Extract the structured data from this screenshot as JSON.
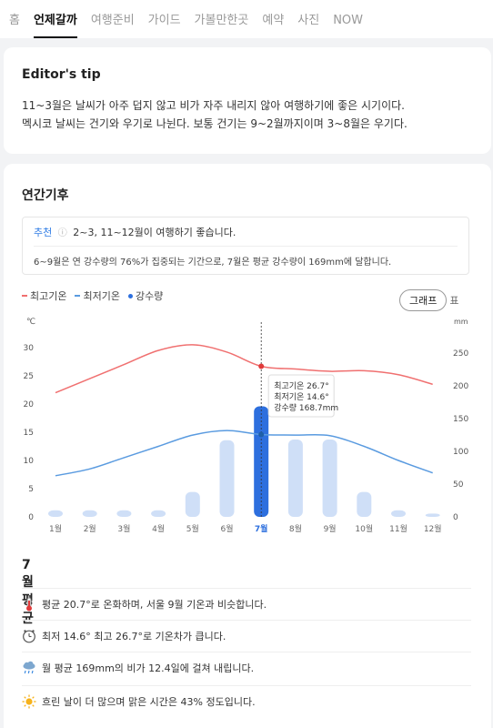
{
  "tabs": [
    "홈",
    "언제갈까",
    "여행준비",
    "가이드",
    "가볼만한곳",
    "예약",
    "사진",
    "NOW"
  ],
  "editor_tip": {
    "title": "Editor's tip",
    "lines": [
      "11~3월은 날씨가 아주 덥지 않고 비가 자주 내리지 않아 여행하기에 좋은 시기이다.",
      "멕시코 날씨는 건기와 우기로 나뉜다. 보통 건기는 9~2월까지이며 3~8월은 우기다."
    ]
  },
  "climate": {
    "title": "연간기후",
    "recommend_label": "추천",
    "recommend_text": "2~3, 11~12월이 여행하기 좋습니다.",
    "note": "6~9월은 연 강수량의 76%가 집중되는 기간으로, 7월은 평균 강수량이 169mm에 달합니다.",
    "legend": [
      "최고기온",
      "최저기온",
      "강수량"
    ],
    "toggle": {
      "graph": "그래프",
      "table": "표"
    },
    "colors": {
      "high": "#f07070",
      "low": "#5a9be0",
      "rain": "#cfdff7",
      "rain_selected": "#2d6fde"
    }
  },
  "chart_data": {
    "type": "line",
    "categories": [
      "1월",
      "2월",
      "3월",
      "4월",
      "5월",
      "6월",
      "7월",
      "8월",
      "9월",
      "10월",
      "11월",
      "12월"
    ],
    "series": [
      {
        "name": "최고기온",
        "values": [
          22,
          24.5,
          27,
          29.5,
          30.5,
          29.2,
          26.7,
          26.2,
          25.8,
          25.9,
          25.2,
          23.5
        ]
      },
      {
        "name": "최저기온",
        "values": [
          7.3,
          8.5,
          10.5,
          12.5,
          14.5,
          15.3,
          14.6,
          14.5,
          14.4,
          12.5,
          10,
          7.8
        ]
      },
      {
        "name": "강수량",
        "values": [
          10,
          10,
          10,
          10,
          38,
          117,
          168.7,
          118,
          118,
          38,
          10,
          5
        ]
      }
    ],
    "y_left": {
      "unit": "℃",
      "ticks": [
        0,
        5,
        10,
        15,
        20,
        25,
        30
      ],
      "range": [
        0,
        35
      ]
    },
    "y_right": {
      "unit": "mm",
      "ticks": [
        0,
        50,
        100,
        150,
        200,
        250
      ],
      "range": [
        0,
        292
      ]
    },
    "selected_month": "7월",
    "tooltip": [
      "최고기온 26.7°",
      "최저기온 14.6°",
      "강수량 168.7mm"
    ]
  },
  "average": {
    "title": "7월 평균",
    "rows": [
      {
        "icon": "thermometer-icon",
        "text": "평균 20.7°로 온화하며, 서울 9월 기온과 비슷합니다."
      },
      {
        "icon": "clock-icon",
        "text": "최저 14.6° 최고 26.7°로 기온차가 큽니다."
      },
      {
        "icon": "rain-cloud-icon",
        "text": "월 평균 169mm의 비가 12.4일에 걸쳐 내립니다."
      },
      {
        "icon": "sun-icon",
        "text": "흐린 날이 더 많으며 맑은 시간은 43% 정도입니다."
      }
    ]
  }
}
